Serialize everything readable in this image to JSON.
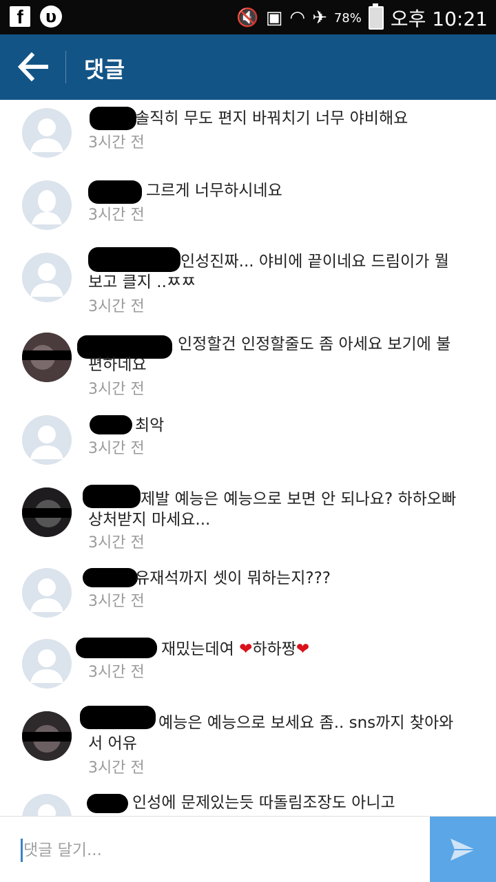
{
  "status_bar": {
    "left_icons": [
      "facebook-icon",
      "app-circle-icon"
    ],
    "right_icons": [
      "mute-icon",
      "nfc-icon",
      "wifi-icon",
      "airplane-icon"
    ],
    "battery": "78%",
    "time": "오후 10:21"
  },
  "header": {
    "title": "댓글"
  },
  "comments": [
    {
      "text": "솔직히 무도 편지 바꿔치기 너무 야비해요",
      "time": "3시간 전"
    },
    {
      "text": "그르게 너무하시네요",
      "time": "3시간 전"
    },
    {
      "text": "인성진짜... 야비에 끝이네요 드림이가 뭘 보고 클지 ..ㅉㅉ",
      "time": "3시간 전"
    },
    {
      "text": "인정할건 인정할줄도 좀 아세요 보기에 불편하네요",
      "time": "3시간 전"
    },
    {
      "text": "최악",
      "time": "3시간 전"
    },
    {
      "text": "제발 예능은 예능으로 보면 안 되나요? 하하오빠 상처받지 마세요...",
      "time": "3시간 전"
    },
    {
      "text": "유재석까지 셋이 뭐하는지???",
      "time": "3시간 전"
    },
    {
      "text": "재밌는데여 ❤하하짱❤",
      "time": "3시간 전"
    },
    {
      "text": "예능은 예능으로 보세요 좀.. sns까지 찾아와서 어유",
      "time": "3시간 전"
    },
    {
      "text": "인성에 문제있는듯 따돌림조장도 아니고",
      "time": ""
    }
  ],
  "input": {
    "placeholder": "댓글 달기..."
  },
  "colors": {
    "header": "#135486",
    "send": "#5aa6e6",
    "username": "#3b6ea5",
    "heart": "#d9121c"
  }
}
